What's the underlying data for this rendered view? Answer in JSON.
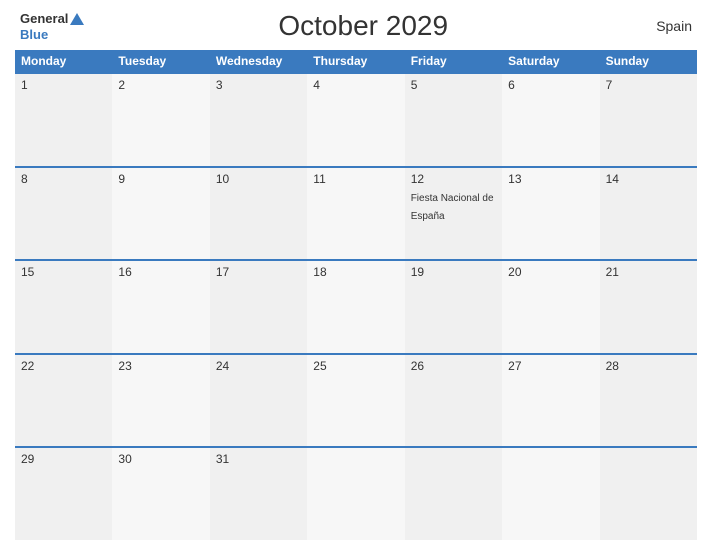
{
  "header": {
    "logo_general": "General",
    "logo_blue": "Blue",
    "title": "October 2029",
    "country": "Spain"
  },
  "calendar": {
    "weekdays": [
      "Monday",
      "Tuesday",
      "Wednesday",
      "Thursday",
      "Friday",
      "Saturday",
      "Sunday"
    ],
    "weeks": [
      [
        {
          "day": "1",
          "event": ""
        },
        {
          "day": "2",
          "event": ""
        },
        {
          "day": "3",
          "event": ""
        },
        {
          "day": "4",
          "event": ""
        },
        {
          "day": "5",
          "event": ""
        },
        {
          "day": "6",
          "event": ""
        },
        {
          "day": "7",
          "event": ""
        }
      ],
      [
        {
          "day": "8",
          "event": ""
        },
        {
          "day": "9",
          "event": ""
        },
        {
          "day": "10",
          "event": ""
        },
        {
          "day": "11",
          "event": ""
        },
        {
          "day": "12",
          "event": "Fiesta Nacional de España"
        },
        {
          "day": "13",
          "event": ""
        },
        {
          "day": "14",
          "event": ""
        }
      ],
      [
        {
          "day": "15",
          "event": ""
        },
        {
          "day": "16",
          "event": ""
        },
        {
          "day": "17",
          "event": ""
        },
        {
          "day": "18",
          "event": ""
        },
        {
          "day": "19",
          "event": ""
        },
        {
          "day": "20",
          "event": ""
        },
        {
          "day": "21",
          "event": ""
        }
      ],
      [
        {
          "day": "22",
          "event": ""
        },
        {
          "day": "23",
          "event": ""
        },
        {
          "day": "24",
          "event": ""
        },
        {
          "day": "25",
          "event": ""
        },
        {
          "day": "26",
          "event": ""
        },
        {
          "day": "27",
          "event": ""
        },
        {
          "day": "28",
          "event": ""
        }
      ],
      [
        {
          "day": "29",
          "event": ""
        },
        {
          "day": "30",
          "event": ""
        },
        {
          "day": "31",
          "event": ""
        },
        {
          "day": "",
          "event": ""
        },
        {
          "day": "",
          "event": ""
        },
        {
          "day": "",
          "event": ""
        },
        {
          "day": "",
          "event": ""
        }
      ]
    ]
  }
}
